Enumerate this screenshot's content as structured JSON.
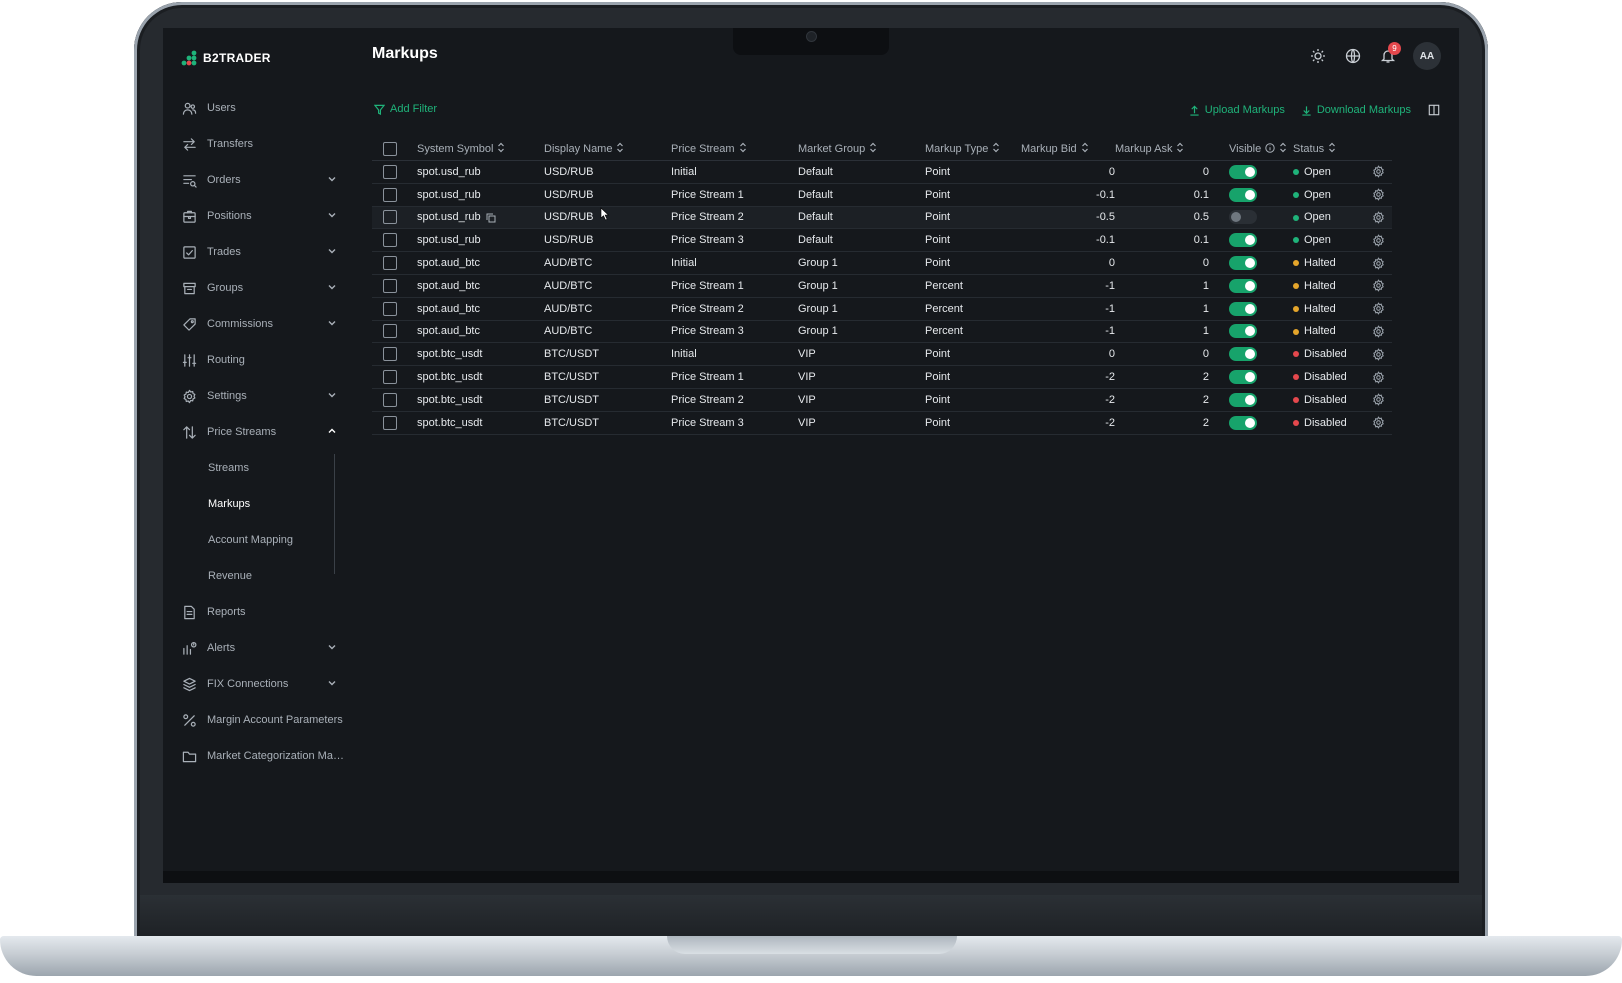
{
  "app": {
    "name": "B2TRADER",
    "page_title": "Markups"
  },
  "colors": {
    "accent": "#1fb37a",
    "open": "#1fb37a",
    "halted": "#e5a52b",
    "disabled": "#e5484d",
    "bg": "#15181c"
  },
  "topbar": {
    "notifications_count": "9",
    "avatar_initials": "AA",
    "icons": [
      "sun-icon",
      "globe-icon",
      "bell-icon"
    ]
  },
  "toolbar": {
    "add_filter": "Add Filter",
    "upload": "Upload Markups",
    "download": "Download Markups"
  },
  "sidebar": {
    "items": [
      {
        "label": "Users",
        "icon": "users-icon",
        "expandable": false
      },
      {
        "label": "Transfers",
        "icon": "transfers-icon",
        "expandable": false
      },
      {
        "label": "Orders",
        "icon": "orders-icon",
        "expandable": true
      },
      {
        "label": "Positions",
        "icon": "positions-icon",
        "expandable": true
      },
      {
        "label": "Trades",
        "icon": "trades-icon",
        "expandable": true
      },
      {
        "label": "Groups",
        "icon": "groups-icon",
        "expandable": true
      },
      {
        "label": "Commissions",
        "icon": "tag-icon",
        "expandable": true
      },
      {
        "label": "Routing",
        "icon": "sliders-icon",
        "expandable": false
      },
      {
        "label": "Settings",
        "icon": "gear-icon",
        "expandable": true
      },
      {
        "label": "Price Streams",
        "icon": "arrows-updown-icon",
        "expandable": true,
        "expanded": true
      }
    ],
    "price_streams_sub": [
      {
        "label": "Streams",
        "active": false
      },
      {
        "label": "Markups",
        "active": true
      },
      {
        "label": "Account Mapping",
        "active": false
      },
      {
        "label": "Revenue",
        "active": false
      }
    ],
    "items_after": [
      {
        "label": "Reports",
        "icon": "document-icon",
        "expandable": false
      },
      {
        "label": "Alerts",
        "icon": "alerts-icon",
        "expandable": true
      },
      {
        "label": "FIX Connections",
        "icon": "layers-icon",
        "expandable": true
      },
      {
        "label": "Margin Account Parameters",
        "icon": "percent-icon",
        "expandable": false
      },
      {
        "label": "Market Categorization Man...",
        "icon": "folder-icon",
        "expandable": false
      }
    ]
  },
  "table": {
    "columns": [
      "System Symbol",
      "Display Name",
      "Price Stream",
      "Market Group",
      "Markup Type",
      "Markup Bid",
      "Markup Ask",
      "Visible",
      "Status"
    ],
    "rows": [
      {
        "symbol": "spot.usd_rub",
        "display": "USD/RUB",
        "stream": "Initial",
        "group": "Default",
        "type": "Point",
        "bid": "0",
        "ask": "0",
        "visible": true,
        "status": "Open"
      },
      {
        "symbol": "spot.usd_rub",
        "display": "USD/RUB",
        "stream": "Price Stream 1",
        "group": "Default",
        "type": "Point",
        "bid": "-0.1",
        "ask": "0.1",
        "visible": true,
        "status": "Open"
      },
      {
        "symbol": "spot.usd_rub",
        "display": "USD/RUB",
        "stream": "Price Stream 2",
        "group": "Default",
        "type": "Point",
        "bid": "-0.5",
        "ask": "0.5",
        "visible": false,
        "status": "Open",
        "hover": true
      },
      {
        "symbol": "spot.usd_rub",
        "display": "USD/RUB",
        "stream": "Price Stream 3",
        "group": "Default",
        "type": "Point",
        "bid": "-0.1",
        "ask": "0.1",
        "visible": true,
        "status": "Open"
      },
      {
        "symbol": "spot.aud_btc",
        "display": "AUD/BTC",
        "stream": "Initial",
        "group": "Group 1",
        "type": "Point",
        "bid": "0",
        "ask": "0",
        "visible": true,
        "status": "Halted"
      },
      {
        "symbol": "spot.aud_btc",
        "display": "AUD/BTC",
        "stream": "Price Stream 1",
        "group": "Group 1",
        "type": "Percent",
        "bid": "-1",
        "ask": "1",
        "visible": true,
        "status": "Halted"
      },
      {
        "symbol": "spot.aud_btc",
        "display": "AUD/BTC",
        "stream": "Price Stream 2",
        "group": "Group 1",
        "type": "Percent",
        "bid": "-1",
        "ask": "1",
        "visible": true,
        "status": "Halted"
      },
      {
        "symbol": "spot.aud_btc",
        "display": "AUD/BTC",
        "stream": "Price Stream 3",
        "group": "Group 1",
        "type": "Percent",
        "bid": "-1",
        "ask": "1",
        "visible": true,
        "status": "Halted"
      },
      {
        "symbol": "spot.btc_usdt",
        "display": "BTC/USDT",
        "stream": "Initial",
        "group": "VIP",
        "type": "Point",
        "bid": "0",
        "ask": "0",
        "visible": true,
        "status": "Disabled"
      },
      {
        "symbol": "spot.btc_usdt",
        "display": "BTC/USDT",
        "stream": "Price Stream 1",
        "group": "VIP",
        "type": "Point",
        "bid": "-2",
        "ask": "2",
        "visible": true,
        "status": "Disabled"
      },
      {
        "symbol": "spot.btc_usdt",
        "display": "BTC/USDT",
        "stream": "Price Stream 2",
        "group": "VIP",
        "type": "Point",
        "bid": "-2",
        "ask": "2",
        "visible": true,
        "status": "Disabled"
      },
      {
        "symbol": "spot.btc_usdt",
        "display": "BTC/USDT",
        "stream": "Price Stream 3",
        "group": "VIP",
        "type": "Point",
        "bid": "-2",
        "ask": "2",
        "visible": true,
        "status": "Disabled"
      }
    ]
  }
}
